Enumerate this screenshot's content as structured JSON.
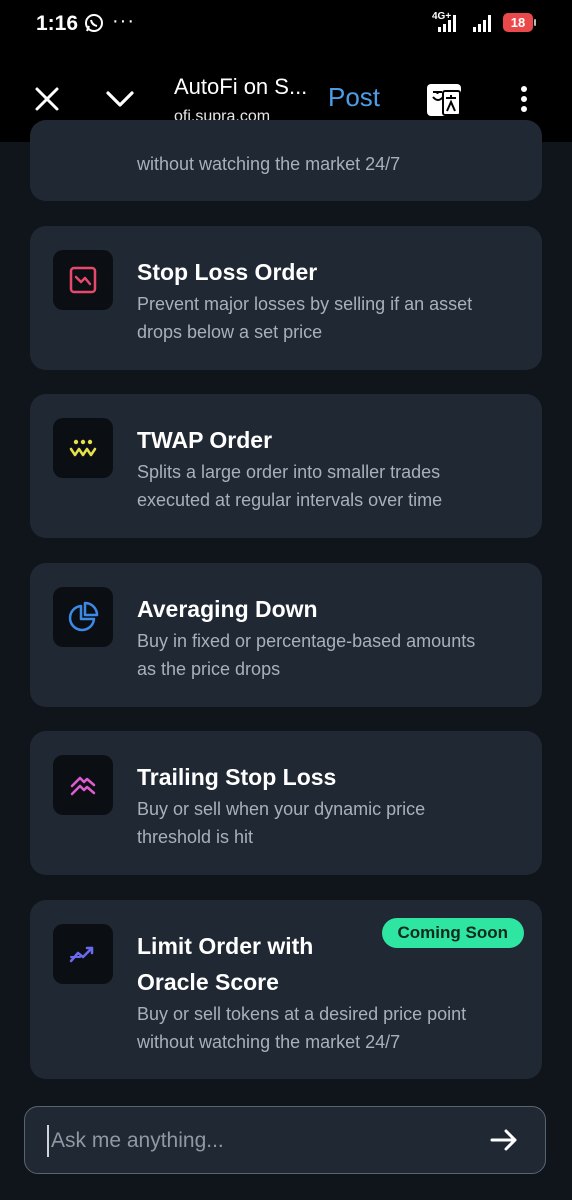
{
  "status_bar": {
    "time": "1:16",
    "whatsapp_icon": "whatsapp-icon",
    "more_dots": "···",
    "network": "4G+",
    "battery": "18"
  },
  "toolbar": {
    "title": "AutoFi on S...",
    "url": "ofi.supra.com",
    "post_label": "Post",
    "icons": [
      "close-icon",
      "chevron-down-icon",
      "translate-icon",
      "more-vert-icon"
    ]
  },
  "cards": [
    {
      "title": "",
      "desc": [
        "without watching the market 24/7"
      ]
    },
    {
      "title": "Stop Loss Order",
      "desc": [
        "Prevent major losses by selling if an asset",
        "drops below a set price"
      ],
      "icon": "stop-loss-icon",
      "icon_color": "#e8486a"
    },
    {
      "title": "TWAP Order",
      "desc": [
        "Splits a large order into smaller trades",
        "executed at regular intervals over time"
      ],
      "icon": "twap-icon",
      "icon_color": "#e6e04a"
    },
    {
      "title": "Averaging Down",
      "desc": [
        "Buy in fixed or percentage-based amounts",
        "as the price drops"
      ],
      "icon": "pie-chart-icon",
      "icon_color": "#3c8ae6"
    },
    {
      "title": "Trailing Stop Loss",
      "desc": [
        "Buy or sell when your dynamic price",
        "threshold is hit"
      ],
      "icon": "trailing-icon",
      "icon_color": "#e05ccf"
    },
    {
      "title": [
        "Limit Order with",
        "Oracle Score"
      ],
      "desc": [
        "Buy or sell tokens at a desired price point",
        "without watching the market 24/7"
      ],
      "badge": "Coming Soon",
      "icon": "trend-icon",
      "icon_color": "#6a6af0"
    }
  ],
  "chat": {
    "placeholder": "Ask me anything...",
    "send_icon": "arrow-right-icon"
  },
  "colors": {
    "background": "#10151c",
    "card": "#1f2833",
    "accent_link": "#4d9de6",
    "badge": "#2ee6a1"
  }
}
